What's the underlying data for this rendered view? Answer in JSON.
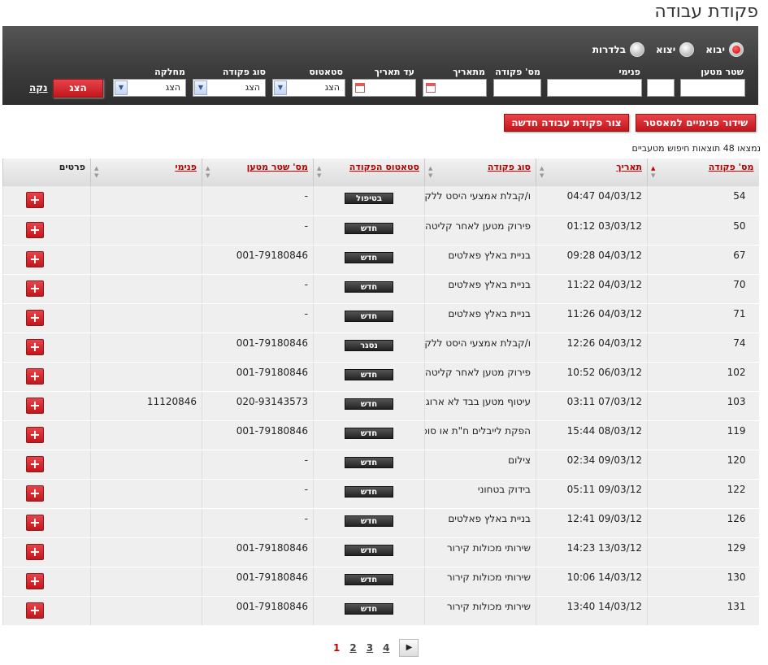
{
  "title": "פקודת עבודה",
  "filters": {
    "radios": [
      {
        "label": "יבוא",
        "selected": true
      },
      {
        "label": "יצוא",
        "selected": false
      },
      {
        "label": "בלדרות",
        "selected": false
      }
    ],
    "labels": {
      "bill": "שטר מטען",
      "internal": "פנימי",
      "order_no": "מס' פקודה",
      "from_date": "מתאריך",
      "to_date": "עד תאריך",
      "status": "סטאטוס",
      "order_type": "סוג פקודה",
      "department": "מחלקה"
    },
    "select_value": "הצג",
    "show_button": "הצג",
    "clear_link": "נקה"
  },
  "actions": {
    "broadcast": "שידור פנימיים למאסטר",
    "create_order": "צור פקודת עבודה חדשה"
  },
  "results_info": "נמצאו 48 תוצאות חיפוש מטעביים",
  "columns": {
    "order_no": "מס' פקודה",
    "date": "תאריך",
    "type": "סוג פקודה",
    "status": "סטאטוס הפקודה",
    "bill": "מס' שטר מטען",
    "internal": "פנימי",
    "details": "פרטים"
  },
  "rows": [
    {
      "num": "54",
      "date": "04/03/12 04:47",
      "type": "ו/קבלת אמצעי היסט ללקוח בצד יבשתי",
      "status": "בטיפול",
      "bill": "-",
      "internal": ""
    },
    {
      "num": "50",
      "date": "03/03/12 01:12",
      "type": "פירוק מטען לאחר קליטה",
      "status": "חדש",
      "bill": "-",
      "internal": ""
    },
    {
      "num": "67",
      "date": "04/03/12 09:28",
      "type": "בניית באלץ פאלטים",
      "status": "חדש",
      "bill": "001-79180846",
      "internal": ""
    },
    {
      "num": "70",
      "date": "04/03/12 11:22",
      "type": "בניית באלץ פאלטים",
      "status": "חדש",
      "bill": "-",
      "internal": ""
    },
    {
      "num": "71",
      "date": "04/03/12 11:26",
      "type": "בניית באלץ פאלטים",
      "status": "חדש",
      "bill": "-",
      "internal": ""
    },
    {
      "num": "74",
      "date": "04/03/12 12:26",
      "type": "ו/קבלת אמצעי היסט ללקוח בצד יבשתי",
      "status": "נסגר",
      "bill": "001-79180846",
      "internal": ""
    },
    {
      "num": "102",
      "date": "06/03/12 10:52",
      "type": "פירוק מטען לאחר קליטה",
      "status": "חדש",
      "bill": "001-79180846",
      "internal": ""
    },
    {
      "num": "103",
      "date": "07/03/12 03:11",
      "type": "עיטוף מטען בבד לא ארוג",
      "status": "חדש",
      "bill": "020-93143573",
      "internal": "11120846"
    },
    {
      "num": "119",
      "date": "08/03/12 15:44",
      "type": "הפקת לייבלים ח\"ת או סוכן למטען",
      "status": "חדש",
      "bill": "001-79180846",
      "internal": ""
    },
    {
      "num": "120",
      "date": "09/03/12 02:34",
      "type": "צילום",
      "status": "חדש",
      "bill": "-",
      "internal": ""
    },
    {
      "num": "122",
      "date": "09/03/12 05:11",
      "type": "בידוק בטחוני",
      "status": "חדש",
      "bill": "-",
      "internal": ""
    },
    {
      "num": "126",
      "date": "09/03/12 12:41",
      "type": "בניית באלץ פאלטים",
      "status": "חדש",
      "bill": "-",
      "internal": ""
    },
    {
      "num": "129",
      "date": "13/03/12 14:23",
      "type": "שירותי מכולות קירור",
      "status": "חדש",
      "bill": "001-79180846",
      "internal": ""
    },
    {
      "num": "130",
      "date": "14/03/12 10:06",
      "type": "שירותי מכולות קירור",
      "status": "חדש",
      "bill": "001-79180846",
      "internal": ""
    },
    {
      "num": "131",
      "date": "14/03/12 13:40",
      "type": "שירותי מכולות קירור",
      "status": "חדש",
      "bill": "001-79180846",
      "internal": ""
    }
  ],
  "pager": {
    "pages": [
      "1",
      "2",
      "3",
      "4"
    ],
    "current": "1",
    "next": "▶"
  }
}
